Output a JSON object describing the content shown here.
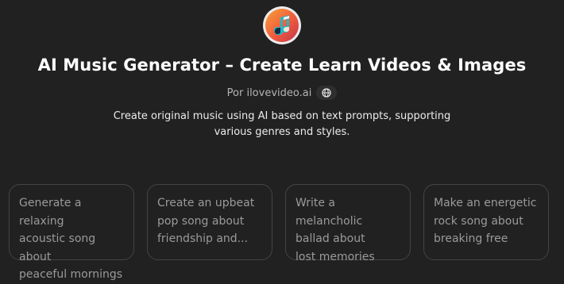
{
  "header": {
    "logo_icon": "music-note-logo-icon",
    "title": "AI Music Generator – Create Learn Videos & Images",
    "author": "Por ilovevideo.ai",
    "globe_icon": "globe-icon",
    "description": "Create original music using AI based on text prompts, supporting various genres and styles."
  },
  "starters": [
    {
      "text": "Generate a relaxing\nacoustic song about\npeaceful mornings"
    },
    {
      "text": "Create an upbeat\npop song about\nfriendship and..."
    },
    {
      "text": "Write a melancholic\nballad about\nlost memories"
    },
    {
      "text": "Make an energetic\nrock song about\nbreaking free"
    }
  ],
  "colors": {
    "background": "#212121",
    "card_border": "#444444",
    "card_text": "#9a9a9a",
    "logo_orange": "#f26b3a",
    "logo_teal": "#1fb8c9"
  }
}
